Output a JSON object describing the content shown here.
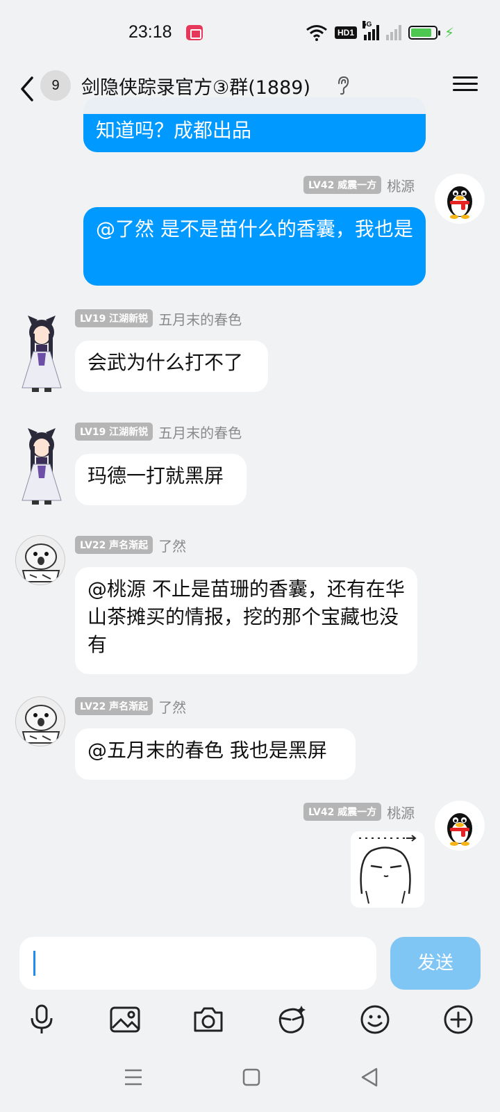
{
  "status": {
    "time": "23:18",
    "hd": "HD1",
    "network": "5G",
    "battery_level": 0.85
  },
  "header": {
    "unread_count": "9",
    "title": "剑隐侠踪录官方③群(1889)"
  },
  "messages": [
    {
      "id": "m0",
      "side": "mine",
      "text": "知道吗？成都出品"
    },
    {
      "id": "m1",
      "side": "mine",
      "level": "LV42 威震一方",
      "sender": "桃源",
      "text": "@了然 是不是苗什么的香囊，我也是"
    },
    {
      "id": "m2",
      "side": "theirs",
      "level": "LV19 江湖新锐",
      "sender": "五月末的春色",
      "text": "会武为什么打不了"
    },
    {
      "id": "m3",
      "side": "theirs",
      "level": "LV19 江湖新锐",
      "sender": "五月末的春色",
      "text": "玛德一打就黑屏"
    },
    {
      "id": "m4",
      "side": "theirs",
      "level": "LV22 声名渐起",
      "sender": "了然",
      "text": "@桃源 不止是苗珊的香囊，还有在华山茶摊买的情报，挖的那个宝藏也没有"
    },
    {
      "id": "m5",
      "side": "theirs",
      "level": "LV22 声名渐起",
      "sender": "了然",
      "text": "@五月末的春色 我也是黑屏"
    },
    {
      "id": "m6",
      "side": "mine",
      "level": "LV42 威震一方",
      "sender": "桃源",
      "sticker": "smiley-face-sticker"
    }
  ],
  "input": {
    "value": "",
    "send_label": "发送"
  },
  "toolbar": [
    "microphone-icon",
    "image-icon",
    "camera-icon",
    "red-packet-icon",
    "emoji-icon",
    "plus-icon"
  ],
  "nav": [
    "menu-icon",
    "home-icon",
    "back-icon"
  ],
  "colors": {
    "my_bubble": "#0099ff",
    "send_disabled": "#80c6f5",
    "badge": "#b5b5b5",
    "battery": "#4cc74f"
  }
}
